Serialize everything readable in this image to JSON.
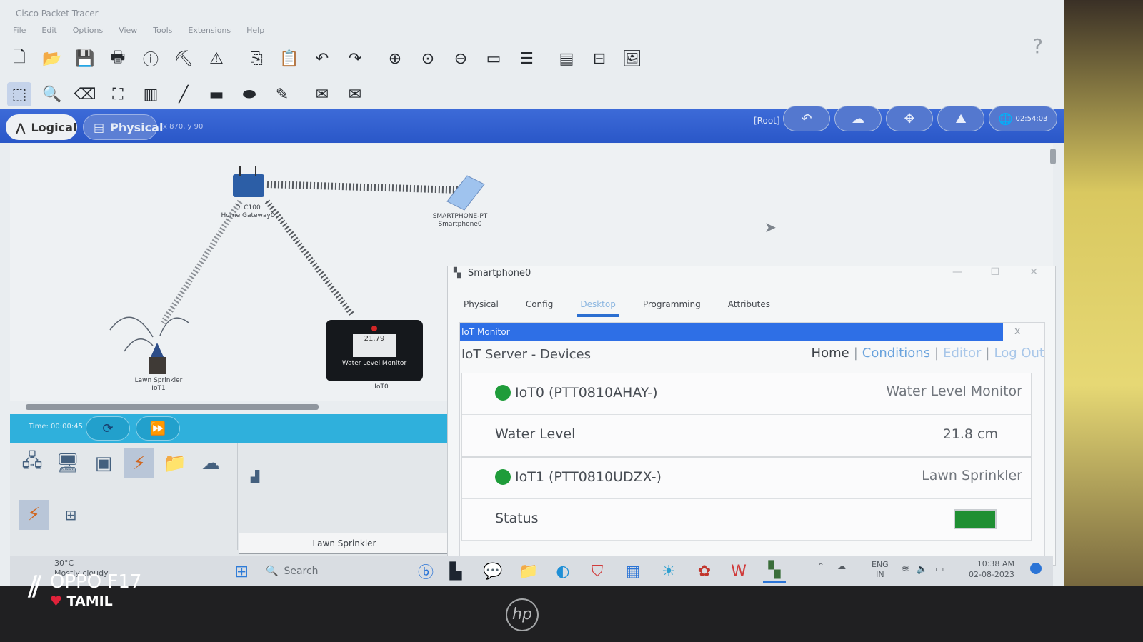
{
  "window": {
    "title": "Cisco Packet Tracer",
    "menu": [
      "File",
      "Edit",
      "Options",
      "View",
      "Tools",
      "Extensions",
      "Help"
    ]
  },
  "workspace": {
    "logical_label": "Logical",
    "physical_label": "Physical",
    "coords": "x 870, y 90",
    "root_label": "[Root]",
    "time_label": "02:54:03"
  },
  "devices": {
    "gateway": {
      "model": "DLC100",
      "name": "Home Gateway0"
    },
    "smartphone": {
      "model": "SMARTPHONE-PT",
      "name": "Smartphone0"
    },
    "sprinkler": {
      "model": "Lawn Sprinkler",
      "name": "IoT1"
    },
    "water_monitor": {
      "model": "Water Level Monitor",
      "name": "IoT0",
      "display_value": "21.79",
      "caption": "Water Level Monitor"
    }
  },
  "realtime": {
    "time": "Time: 00:00:45"
  },
  "palette": {
    "selected_device": "Lawn Sprinkler"
  },
  "smartphone_window": {
    "title": "Smartphone0",
    "tabs": [
      "Physical",
      "Config",
      "Desktop",
      "Programming",
      "Attributes"
    ],
    "active_tab": "Desktop",
    "iot_monitor": {
      "header": "IoT Monitor",
      "close": "x",
      "server_title": "IoT Server - Devices",
      "nav": {
        "home": "Home",
        "conditions": "Conditions",
        "editor": "Editor",
        "logout": "Log Out",
        "sep": "|"
      },
      "device_list": [
        {
          "name": "IoT0 (PTT0810AHAY-)",
          "type": "Water Level Monitor",
          "sensor_label": "Water Level",
          "sensor_value": "21.8 cm",
          "status_color": "#1f9c3a"
        },
        {
          "name": "IoT1 (PTT0810UDZX-)",
          "type": "Lawn Sprinkler",
          "sensor_label": "Status",
          "sensor_value": "",
          "status_color": "#1f9c3a"
        }
      ]
    }
  },
  "taskbar": {
    "weather_temp": "30°C",
    "weather_desc": "Mostly cloudy",
    "search_placeholder": "Search",
    "lang_line1": "ENG",
    "lang_line2": "IN",
    "clock_time": "10:38 AM",
    "clock_date": "02-08-2023",
    "chat_badge": "1"
  },
  "overlay": {
    "brand_model": "OPPO F17",
    "brand_sub": "TAMIL",
    "laptop_logo": "hp"
  },
  "colors": {
    "accent_blue": "#2e6fe6",
    "realtime_cyan": "#2fb0dc",
    "status_green": "#1f9c3a"
  }
}
